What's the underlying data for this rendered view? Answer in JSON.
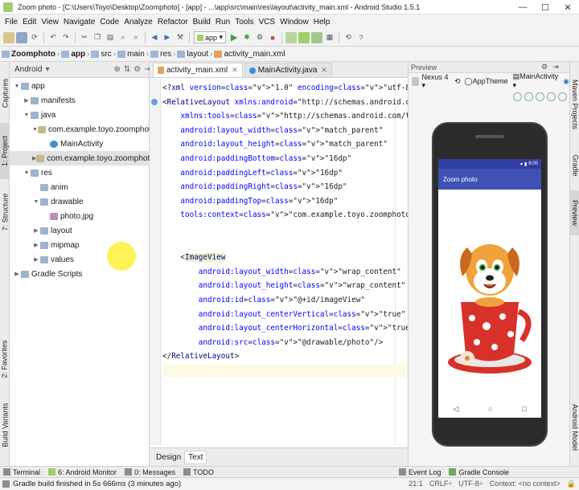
{
  "window": {
    "title": "Zoom photo - [C:\\Users\\Toyo\\Desktop\\Zoomphoto] - [app] - ...\\app\\src\\main\\res\\layout\\activity_main.xml - Android Studio 1.5.1",
    "minimize": "—",
    "maximize": "☐",
    "close": "✕"
  },
  "menu": [
    "File",
    "Edit",
    "View",
    "Navigate",
    "Code",
    "Analyze",
    "Refactor",
    "Build",
    "Run",
    "Tools",
    "VCS",
    "Window",
    "Help"
  ],
  "toolbar": {
    "config": "app"
  },
  "breadcrumbs": [
    "Zoomphoto",
    "app",
    "src",
    "main",
    "res",
    "layout",
    "activity_main.xml"
  ],
  "project": {
    "view_selector": "Android",
    "tree": [
      {
        "label": "app",
        "kind": "folder",
        "depth": 0,
        "arrow": "▼"
      },
      {
        "label": "manifests",
        "kind": "folder",
        "depth": 1,
        "arrow": "▶"
      },
      {
        "label": "java",
        "kind": "folder",
        "depth": 1,
        "arrow": "▼"
      },
      {
        "label": "com.example.toyo.zoomphoto",
        "kind": "pkg",
        "depth": 2,
        "arrow": "▼"
      },
      {
        "label": "MainActivity",
        "kind": "cls",
        "depth": 3,
        "arrow": ""
      },
      {
        "label": "com.example.toyo.zoomphoto (androidTest)",
        "kind": "pkg",
        "depth": 2,
        "arrow": "▶"
      },
      {
        "label": "res",
        "kind": "folder",
        "depth": 1,
        "arrow": "▼"
      },
      {
        "label": "anim",
        "kind": "folder",
        "depth": 2,
        "arrow": ""
      },
      {
        "label": "drawable",
        "kind": "folder",
        "depth": 2,
        "arrow": "▼"
      },
      {
        "label": "photo.jpg",
        "kind": "img",
        "depth": 3,
        "arrow": ""
      },
      {
        "label": "layout",
        "kind": "folder",
        "depth": 2,
        "arrow": "▶"
      },
      {
        "label": "mipmap",
        "kind": "folder",
        "depth": 2,
        "arrow": "▶"
      },
      {
        "label": "values",
        "kind": "folder",
        "depth": 2,
        "arrow": "▶"
      },
      {
        "label": "Gradle Scripts",
        "kind": "folder",
        "depth": 0,
        "arrow": "▶"
      }
    ]
  },
  "left_tabs": [
    "Captures",
    "1: Project",
    "7: Structure",
    "2: Favorites",
    "Build Variants"
  ],
  "right_tabs": [
    "Maven Projects",
    "Gradle",
    "Preview",
    "Android Model"
  ],
  "editor": {
    "tabs": [
      "activity_main.xml",
      "MainActivity.java"
    ],
    "lines": [
      "<?xml version=\"1.0\" encoding=\"utf-8\"?>",
      "<RelativeLayout xmlns:android=\"http://schemas.android.com/apk/r",
      "    xmlns:tools=\"http://schemas.android.com/tools\"",
      "    android:layout_width=\"match_parent\"",
      "    android:layout_height=\"match_parent\"",
      "    android:paddingBottom=\"16dp\"",
      "    android:paddingLeft=\"16dp\"",
      "    android:paddingRight=\"16dp\"",
      "    android:paddingTop=\"16dp\"",
      "    tools:context=\"com.example.toyo.zoomphoto.MainActivity\">",
      "",
      "",
      "    <ImageView",
      "        android:layout_width=\"wrap_content\"",
      "        android:layout_height=\"wrap_content\"",
      "        android:id=\"@+id/imageView\"",
      "        android:layout_centerVertical=\"true\"",
      "        android:layout_centerHorizontal=\"true\"",
      "        android:src=\"@drawable/photo\"/>",
      "</RelativeLayout>",
      ""
    ],
    "bottom_tabs": [
      "Design",
      "Text"
    ]
  },
  "preview": {
    "header": "Preview",
    "device": "Nexus 4",
    "theme": "AppTheme",
    "activity": "MainActivity",
    "app_title": "Zoom photo",
    "clock": "6:00",
    "nav": [
      "◁",
      "○",
      "□"
    ]
  },
  "bottom_tools": [
    "Terminal",
    "6: Android Monitor",
    "0: Messages",
    "TODO"
  ],
  "bottom_tools_right": [
    "Event Log",
    "Gradle Console"
  ],
  "status": {
    "message": "Gradle build finished in 5s 666ms (3 minutes ago)",
    "position": "21:1",
    "line_sep": "CRLF÷",
    "encoding": "UTF-8÷",
    "context": "Context: <no context>"
  },
  "colors": {
    "accent": "#3f51b5",
    "status_bar": "#303f9f"
  }
}
